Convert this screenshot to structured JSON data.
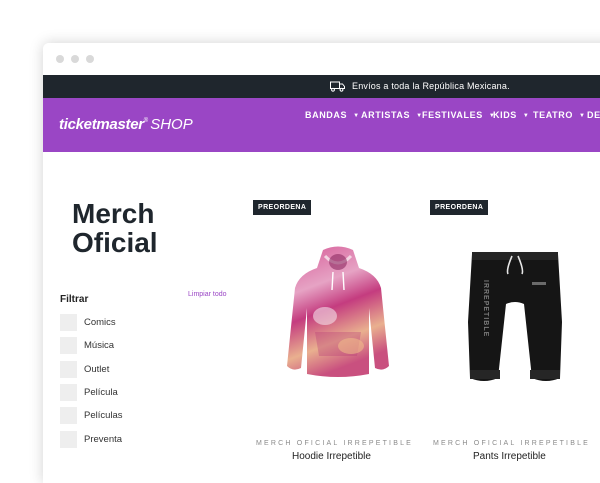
{
  "shipping_bar": {
    "icon": "truck-icon",
    "text": "Envíos a toda la República Mexicana."
  },
  "brand": {
    "name": "ticketmaster",
    "mark": "®",
    "suffix": "SHOP"
  },
  "nav": {
    "items": [
      {
        "label": "BANDAS"
      },
      {
        "label": "ARTISTAS"
      },
      {
        "label": "FESTIVALES"
      },
      {
        "label": "KIDS"
      },
      {
        "label": "TEATRO"
      },
      {
        "label": "DE"
      }
    ]
  },
  "page": {
    "title": "Merch Oficial"
  },
  "filters": {
    "label": "Filtrar",
    "clear_label": "Limpiar todo",
    "items": [
      {
        "label": "Comics"
      },
      {
        "label": "Música"
      },
      {
        "label": "Outlet"
      },
      {
        "label": "Película"
      },
      {
        "label": "Películas"
      },
      {
        "label": "Preventa"
      }
    ]
  },
  "products": [
    {
      "badge": "PREORDENA",
      "category": "MERCH OFICIAL IRREPETIBLE",
      "name": "Hoodie Irrepetible",
      "image": "tie-dye-hoodie"
    },
    {
      "badge": "PREORDENA",
      "category": "MERCH OFICIAL IRREPETIBLE",
      "name": "Pants Irrepetible",
      "image": "black-sweatpants"
    }
  ],
  "colors": {
    "accent": "#9a46c5",
    "dark": "#1f262d"
  }
}
